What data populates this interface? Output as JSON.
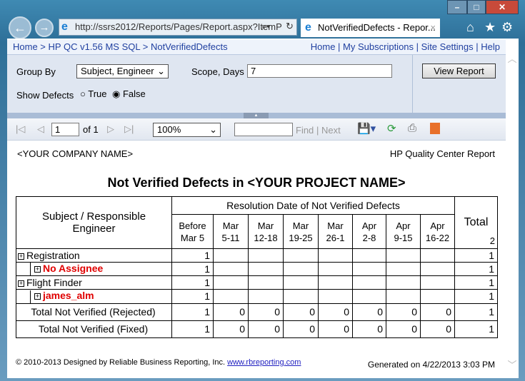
{
  "browser": {
    "url": "http://ssrs2012/Reports/Pages/Report.aspx?ItemP",
    "tab_title": "NotVerifiedDefects - Repor..."
  },
  "breadcrumb": [
    "Home",
    "HP QC v1.56 MS SQL",
    "NotVerifiedDefects"
  ],
  "top_links": [
    "Home",
    "My Subscriptions",
    "Site Settings",
    "Help"
  ],
  "params": {
    "group_by_label": "Group By",
    "group_by_value": "Subject, Engineer",
    "scope_label": "Scope, Days",
    "scope_value": "7",
    "show_defects_label": "Show Defects",
    "opt_true": "True",
    "opt_false": "False",
    "selected": "False",
    "view_report": "View Report"
  },
  "toolbar": {
    "page": "1",
    "of": "of 1",
    "zoom": "100%",
    "find": "Find",
    "sep": "|",
    "next": "Next"
  },
  "report": {
    "company": "<YOUR COMPANY NAME>",
    "product": "HP Quality Center Report",
    "title": "Not Verified Defects in <YOUR PROJECT NAME>",
    "row_header": "Subject / Responsible Engineer",
    "group_header": "Resolution Date of Not Verified Defects",
    "total_header": "Total",
    "total_header_count": "2",
    "columns": [
      [
        "Before",
        "Mar 5"
      ],
      [
        "Mar",
        "5-11"
      ],
      [
        "Mar",
        "12-18"
      ],
      [
        "Mar",
        "19-25"
      ],
      [
        "Mar",
        "26-1"
      ],
      [
        "Apr",
        "2-8"
      ],
      [
        "Apr",
        "9-15"
      ],
      [
        "Apr",
        "16-22"
      ]
    ],
    "rows": [
      {
        "label": "Registration",
        "indent": 0,
        "red": false,
        "toggle": true,
        "values": [
          "1",
          "",
          "",
          "",
          "",
          "",
          "",
          ""
        ],
        "total": "1"
      },
      {
        "label": "No Assignee",
        "indent": 1,
        "red": true,
        "toggle": true,
        "values": [
          "1",
          "",
          "",
          "",
          "",
          "",
          "",
          ""
        ],
        "total": "1"
      },
      {
        "label": "Flight Finder",
        "indent": 0,
        "red": false,
        "toggle": true,
        "values": [
          "1",
          "",
          "",
          "",
          "",
          "",
          "",
          ""
        ],
        "total": "1"
      },
      {
        "label": "james_alm",
        "indent": 1,
        "red": true,
        "toggle": true,
        "values": [
          "1",
          "",
          "",
          "",
          "",
          "",
          "",
          ""
        ],
        "total": "1"
      },
      {
        "label": "Total Not Verified (Rejected)",
        "indent": 0,
        "red": false,
        "toggle": false,
        "values": [
          "1",
          "0",
          "0",
          "0",
          "0",
          "0",
          "0",
          "0"
        ],
        "total": "1"
      },
      {
        "label": "Total Not Verified (Fixed)",
        "indent": 0,
        "red": false,
        "toggle": false,
        "values": [
          "1",
          "0",
          "0",
          "0",
          "0",
          "0",
          "0",
          "0"
        ],
        "total": "1"
      }
    ],
    "footer_copyright": "© 2010-2013 Designed by Reliable Business Reporting, Inc.",
    "footer_link": "www.rbreporting.com",
    "generated": "Generated on 4/22/2013 3:03 PM"
  }
}
